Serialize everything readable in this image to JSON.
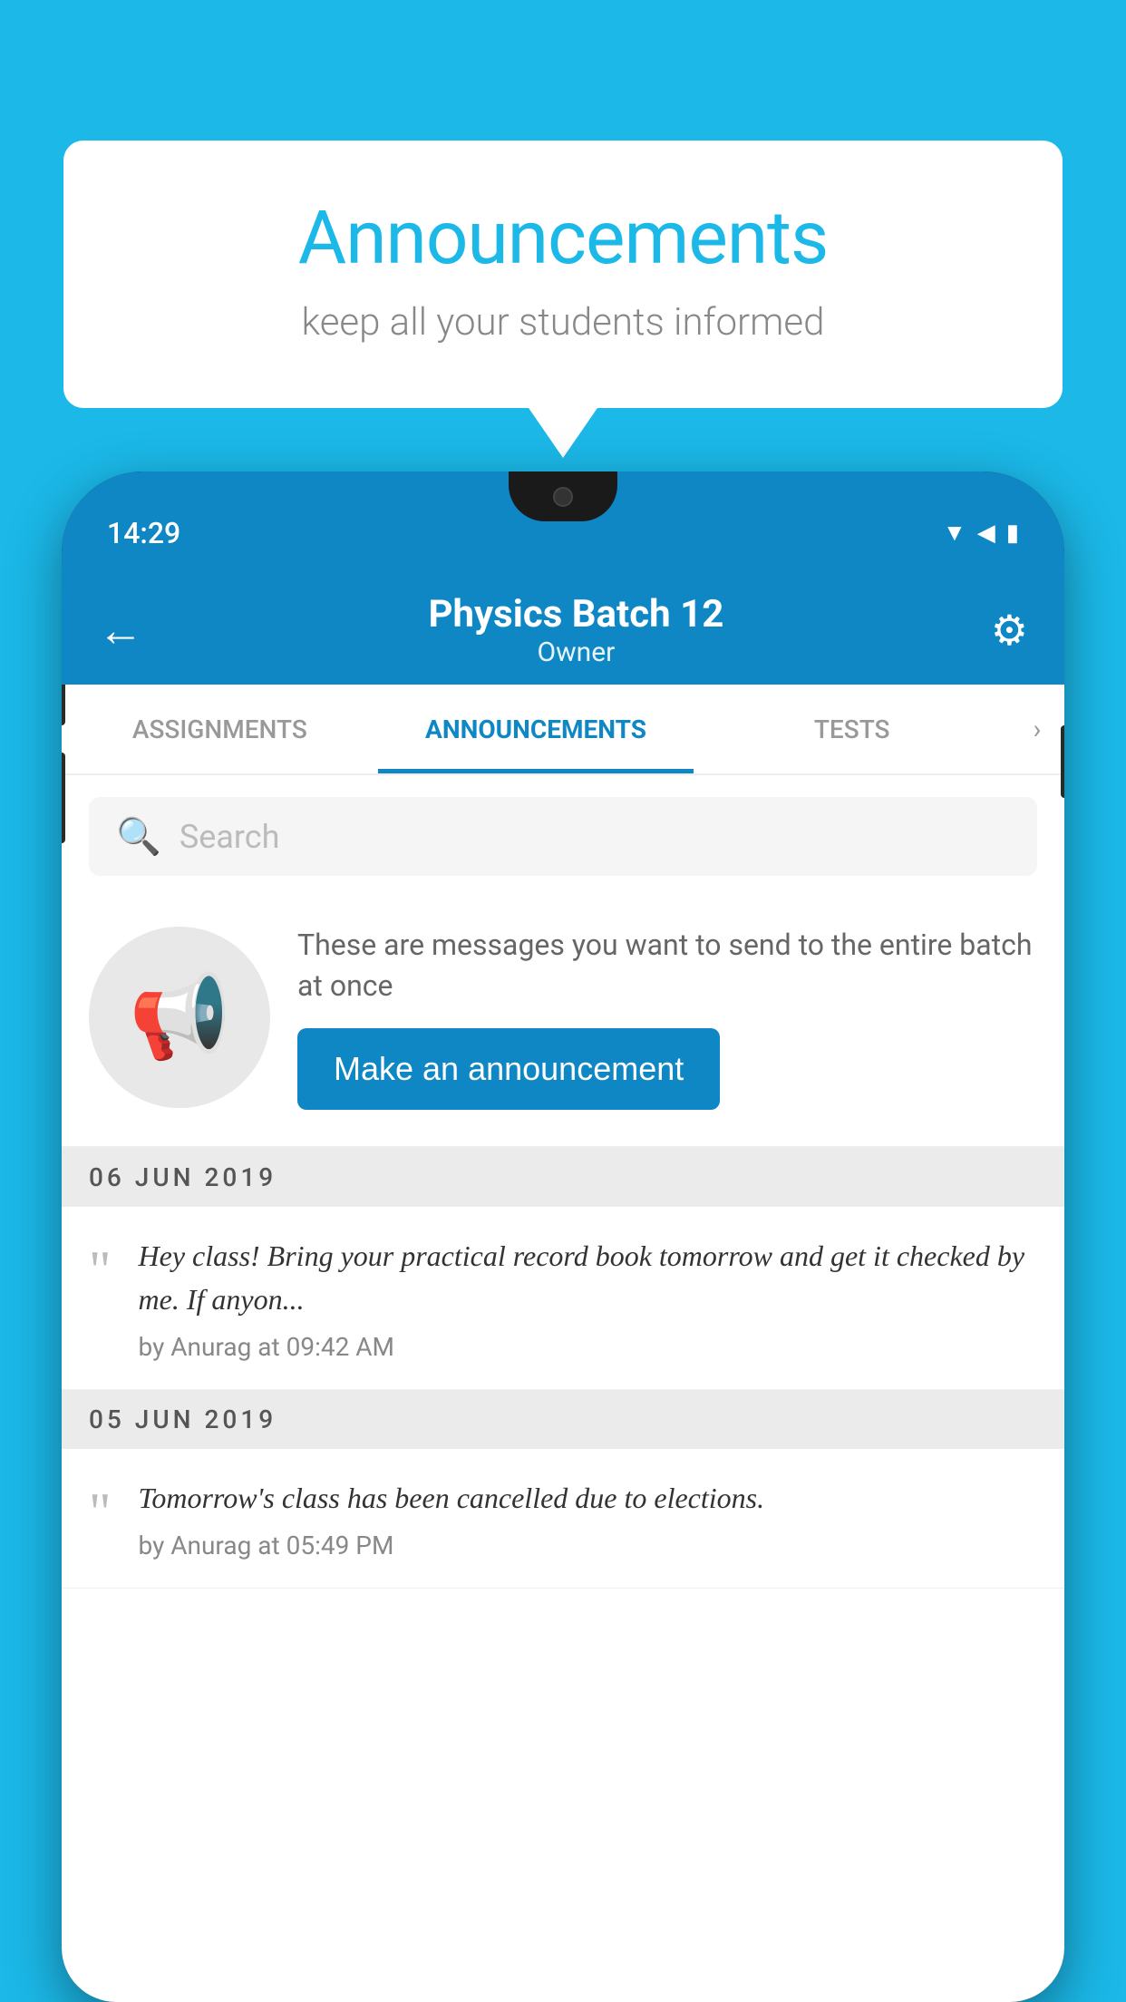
{
  "page": {
    "background_color": "#1BB8E8"
  },
  "speech_bubble": {
    "title": "Announcements",
    "subtitle": "keep all your students informed"
  },
  "phone": {
    "status_bar": {
      "time": "14:29",
      "icons": [
        "wifi",
        "signal",
        "battery"
      ]
    },
    "app_bar": {
      "batch_name": "Physics Batch 12",
      "batch_role": "Owner",
      "back_label": "←",
      "settings_label": "⚙"
    },
    "tabs": [
      {
        "id": "assignments",
        "label": "ASSIGNMENTS",
        "active": false
      },
      {
        "id": "announcements",
        "label": "ANNOUNCEMENTS",
        "active": true
      },
      {
        "id": "tests",
        "label": "TESTS",
        "active": false
      }
    ],
    "search": {
      "placeholder": "Search"
    },
    "announcement_prompt": {
      "description_text": "These are messages you want to send to the entire batch at once",
      "button_label": "Make an announcement"
    },
    "announcements": [
      {
        "date": "06  JUN  2019",
        "items": [
          {
            "text": "Hey class! Bring your practical record book tomorrow and get it checked by me. If anyon...",
            "meta": "by Anurag at 09:42 AM"
          }
        ]
      },
      {
        "date": "05  JUN  2019",
        "items": [
          {
            "text": "Tomorrow's class has been cancelled due to elections.",
            "meta": "by Anurag at 05:49 PM"
          }
        ]
      }
    ]
  }
}
